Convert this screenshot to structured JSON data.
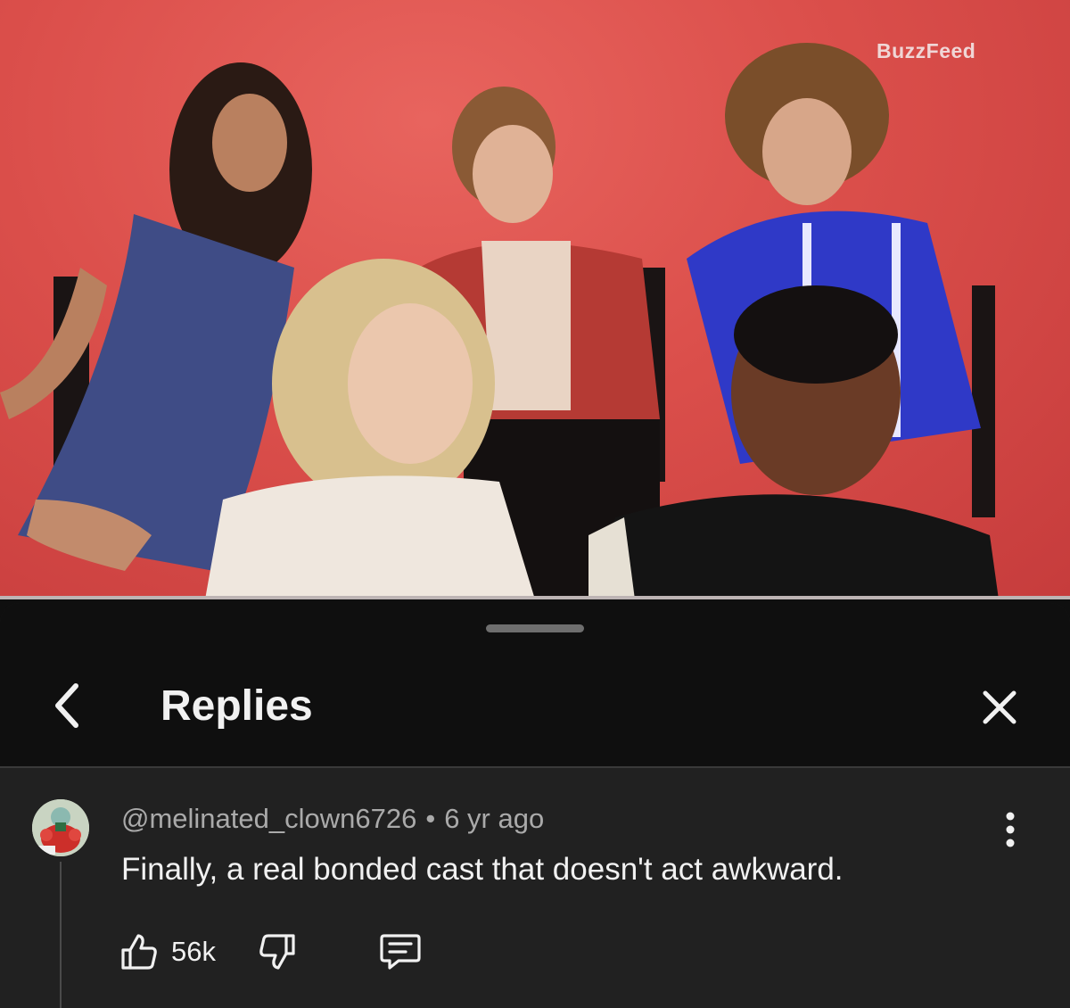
{
  "video": {
    "watermark": "BuzzFeed",
    "progress": 0.0
  },
  "sheet": {
    "title": "Replies",
    "back_icon": "chevron-left-icon",
    "close_icon": "close-icon"
  },
  "comment": {
    "author": "@melinated_clown6726",
    "separator": "•",
    "age": "6 yr ago",
    "text": "Finally, a real bonded cast that doesn't act awkward.",
    "likes": "56k",
    "menu_icon": "more-vert-icon",
    "like_icon": "thumb-up-icon",
    "dislike_icon": "thumb-down-icon",
    "reply_icon": "reply-comment-icon"
  },
  "colors": {
    "background": "#0f0f0f",
    "sheet": "#212121",
    "video_backdrop": "#db4f4b",
    "secondary_text": "#aaaaaa"
  }
}
